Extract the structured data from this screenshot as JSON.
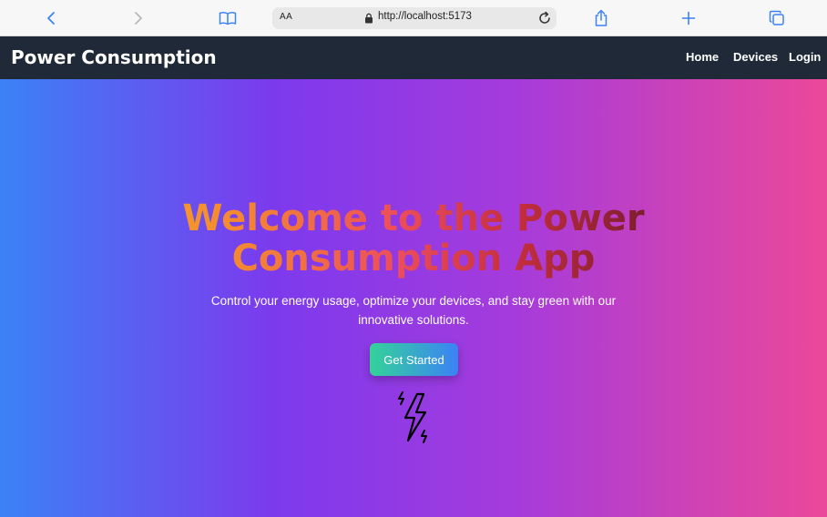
{
  "browser": {
    "reader_label": "AA",
    "url": "http://localhost:5173"
  },
  "navbar": {
    "brand": "Power Consumption",
    "links": [
      "Home",
      "Devices",
      "Login"
    ]
  },
  "hero": {
    "title": "Welcome to the Power Consumption App",
    "subtitle": "Control your energy usage, optimize your devices, and stay green with our innovative solutions.",
    "cta_label": "Get Started",
    "icon": "lightning-bolt-icon"
  },
  "colors": {
    "navbar_bg": "#1f2937",
    "hero_gradient": [
      "#3b82f6",
      "#7c3aed",
      "#ec4899"
    ],
    "cta_gradient": [
      "#34d399",
      "#3b82f6"
    ]
  }
}
